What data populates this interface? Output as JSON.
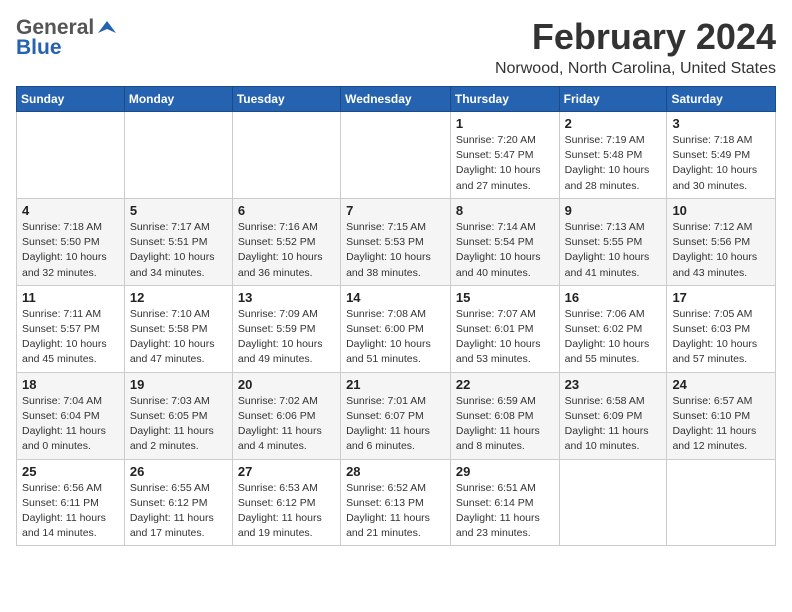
{
  "app": {
    "logo_general": "General",
    "logo_blue": "Blue",
    "month_title": "February 2024",
    "location": "Norwood, North Carolina, United States"
  },
  "calendar": {
    "days_of_week": [
      "Sunday",
      "Monday",
      "Tuesday",
      "Wednesday",
      "Thursday",
      "Friday",
      "Saturday"
    ],
    "weeks": [
      [
        {
          "day": "",
          "info": ""
        },
        {
          "day": "",
          "info": ""
        },
        {
          "day": "",
          "info": ""
        },
        {
          "day": "",
          "info": ""
        },
        {
          "day": "1",
          "info": "Sunrise: 7:20 AM\nSunset: 5:47 PM\nDaylight: 10 hours\nand 27 minutes."
        },
        {
          "day": "2",
          "info": "Sunrise: 7:19 AM\nSunset: 5:48 PM\nDaylight: 10 hours\nand 28 minutes."
        },
        {
          "day": "3",
          "info": "Sunrise: 7:18 AM\nSunset: 5:49 PM\nDaylight: 10 hours\nand 30 minutes."
        }
      ],
      [
        {
          "day": "4",
          "info": "Sunrise: 7:18 AM\nSunset: 5:50 PM\nDaylight: 10 hours\nand 32 minutes."
        },
        {
          "day": "5",
          "info": "Sunrise: 7:17 AM\nSunset: 5:51 PM\nDaylight: 10 hours\nand 34 minutes."
        },
        {
          "day": "6",
          "info": "Sunrise: 7:16 AM\nSunset: 5:52 PM\nDaylight: 10 hours\nand 36 minutes."
        },
        {
          "day": "7",
          "info": "Sunrise: 7:15 AM\nSunset: 5:53 PM\nDaylight: 10 hours\nand 38 minutes."
        },
        {
          "day": "8",
          "info": "Sunrise: 7:14 AM\nSunset: 5:54 PM\nDaylight: 10 hours\nand 40 minutes."
        },
        {
          "day": "9",
          "info": "Sunrise: 7:13 AM\nSunset: 5:55 PM\nDaylight: 10 hours\nand 41 minutes."
        },
        {
          "day": "10",
          "info": "Sunrise: 7:12 AM\nSunset: 5:56 PM\nDaylight: 10 hours\nand 43 minutes."
        }
      ],
      [
        {
          "day": "11",
          "info": "Sunrise: 7:11 AM\nSunset: 5:57 PM\nDaylight: 10 hours\nand 45 minutes."
        },
        {
          "day": "12",
          "info": "Sunrise: 7:10 AM\nSunset: 5:58 PM\nDaylight: 10 hours\nand 47 minutes."
        },
        {
          "day": "13",
          "info": "Sunrise: 7:09 AM\nSunset: 5:59 PM\nDaylight: 10 hours\nand 49 minutes."
        },
        {
          "day": "14",
          "info": "Sunrise: 7:08 AM\nSunset: 6:00 PM\nDaylight: 10 hours\nand 51 minutes."
        },
        {
          "day": "15",
          "info": "Sunrise: 7:07 AM\nSunset: 6:01 PM\nDaylight: 10 hours\nand 53 minutes."
        },
        {
          "day": "16",
          "info": "Sunrise: 7:06 AM\nSunset: 6:02 PM\nDaylight: 10 hours\nand 55 minutes."
        },
        {
          "day": "17",
          "info": "Sunrise: 7:05 AM\nSunset: 6:03 PM\nDaylight: 10 hours\nand 57 minutes."
        }
      ],
      [
        {
          "day": "18",
          "info": "Sunrise: 7:04 AM\nSunset: 6:04 PM\nDaylight: 11 hours\nand 0 minutes."
        },
        {
          "day": "19",
          "info": "Sunrise: 7:03 AM\nSunset: 6:05 PM\nDaylight: 11 hours\nand 2 minutes."
        },
        {
          "day": "20",
          "info": "Sunrise: 7:02 AM\nSunset: 6:06 PM\nDaylight: 11 hours\nand 4 minutes."
        },
        {
          "day": "21",
          "info": "Sunrise: 7:01 AM\nSunset: 6:07 PM\nDaylight: 11 hours\nand 6 minutes."
        },
        {
          "day": "22",
          "info": "Sunrise: 6:59 AM\nSunset: 6:08 PM\nDaylight: 11 hours\nand 8 minutes."
        },
        {
          "day": "23",
          "info": "Sunrise: 6:58 AM\nSunset: 6:09 PM\nDaylight: 11 hours\nand 10 minutes."
        },
        {
          "day": "24",
          "info": "Sunrise: 6:57 AM\nSunset: 6:10 PM\nDaylight: 11 hours\nand 12 minutes."
        }
      ],
      [
        {
          "day": "25",
          "info": "Sunrise: 6:56 AM\nSunset: 6:11 PM\nDaylight: 11 hours\nand 14 minutes."
        },
        {
          "day": "26",
          "info": "Sunrise: 6:55 AM\nSunset: 6:12 PM\nDaylight: 11 hours\nand 17 minutes."
        },
        {
          "day": "27",
          "info": "Sunrise: 6:53 AM\nSunset: 6:12 PM\nDaylight: 11 hours\nand 19 minutes."
        },
        {
          "day": "28",
          "info": "Sunrise: 6:52 AM\nSunset: 6:13 PM\nDaylight: 11 hours\nand 21 minutes."
        },
        {
          "day": "29",
          "info": "Sunrise: 6:51 AM\nSunset: 6:14 PM\nDaylight: 11 hours\nand 23 minutes."
        },
        {
          "day": "",
          "info": ""
        },
        {
          "day": "",
          "info": ""
        }
      ]
    ]
  }
}
